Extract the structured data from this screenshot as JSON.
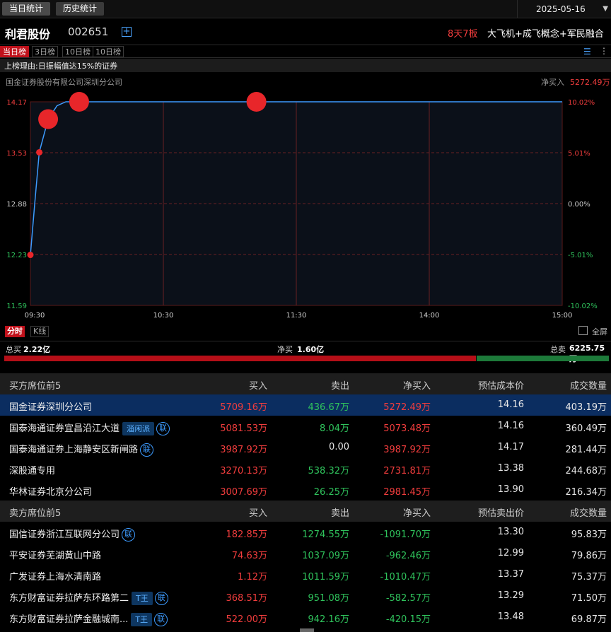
{
  "tabs": {
    "today": "当日统计",
    "history": "历史统计"
  },
  "date": "2025-05-16",
  "stock": {
    "name": "利君股份",
    "code": "002651",
    "board_count": "8天7板",
    "concept": "大飞机+成飞概念+军民融合"
  },
  "range_tabs": [
    "当日榜",
    "3日榜",
    "10日榜",
    "10日榜"
  ],
  "reason": "上榜理由:日振幅值达15%的证券",
  "broker": "国金证券股份有限公司深圳分公司",
  "net_buy": {
    "label": "净买入",
    "value": "5272.49万"
  },
  "chart_data": {
    "type": "line",
    "y_left_ticks": [
      "14.17",
      "13.53",
      "12.88",
      "12.23",
      "11.59"
    ],
    "y_right_ticks": [
      "10.02%",
      "5.01%",
      "0.00%",
      "-5.01%",
      "-10.02%"
    ],
    "y_range": [
      11.59,
      14.17
    ],
    "x_ticks": [
      "09:30",
      "10:30",
      "11:30",
      "14:00",
      "15:00"
    ],
    "line": [
      [
        0,
        12.23
      ],
      [
        2,
        12.9
      ],
      [
        4,
        13.53
      ],
      [
        8,
        13.95
      ],
      [
        12,
        14.12
      ],
      [
        16,
        14.17
      ],
      [
        240,
        14.17
      ]
    ],
    "points": [
      {
        "t": 0,
        "y": 12.23,
        "size": "small"
      },
      {
        "t": 4,
        "y": 13.53,
        "size": "small"
      },
      {
        "t": 8,
        "y": 13.95,
        "size": "large"
      },
      {
        "t": 22,
        "y": 14.17,
        "size": "large"
      },
      {
        "t": 102,
        "y": 14.17,
        "size": "large"
      }
    ]
  },
  "chart_controls": {
    "fenshi": "分时",
    "kline": "K线",
    "fullscreen": "全屏"
  },
  "totals": {
    "buy_label": "总买",
    "buy": "2.22亿",
    "net_label": "净买",
    "net": "1.60亿",
    "sell_label": "总卖",
    "sell": "6225.75万",
    "buy_ratio": 0.78
  },
  "buy_table": {
    "headers": [
      "买方席位前5",
      "买入",
      "卖出",
      "净买入",
      "预估成本价",
      "成交数量"
    ],
    "rows": [
      {
        "name": "国金证券深圳分公司",
        "tag": "",
        "lian": false,
        "buy": "5709.16万",
        "sell": "436.67万",
        "net": "5272.49万",
        "price": "14.16",
        "vol": "403.19万"
      },
      {
        "name": "国泰海通证券宜昌沿江大道",
        "tag": "淄闲派",
        "lian": true,
        "buy": "5081.53万",
        "sell": "8.04万",
        "net": "5073.48万",
        "price": "14.16",
        "vol": "360.49万"
      },
      {
        "name": "国泰海通证券上海静安区新闸路",
        "tag": "",
        "lian": true,
        "buy": "3987.92万",
        "sell": "0.00",
        "net": "3987.92万",
        "price": "14.17",
        "vol": "281.44万"
      },
      {
        "name": "深股通专用",
        "tag": "",
        "lian": false,
        "buy": "3270.13万",
        "sell": "538.32万",
        "net": "2731.81万",
        "price": "13.38",
        "vol": "244.68万"
      },
      {
        "name": "华林证券北京分公司",
        "tag": "",
        "lian": false,
        "buy": "3007.69万",
        "sell": "26.25万",
        "net": "2981.45万",
        "price": "13.90",
        "vol": "216.34万"
      }
    ]
  },
  "sell_table": {
    "headers": [
      "卖方席位前5",
      "买入",
      "卖出",
      "净买入",
      "预估卖出价",
      "成交数量"
    ],
    "rows": [
      {
        "name": "国信证券浙江互联网分公司",
        "tag": "",
        "lian": true,
        "buy": "182.85万",
        "sell": "1274.55万",
        "net": "-1091.70万",
        "price": "13.30",
        "vol": "95.83万"
      },
      {
        "name": "平安证券芜湖黄山中路",
        "tag": "",
        "lian": false,
        "buy": "74.63万",
        "sell": "1037.09万",
        "net": "-962.46万",
        "price": "12.99",
        "vol": "79.86万"
      },
      {
        "name": "广发证券上海水清南路",
        "tag": "",
        "lian": false,
        "buy": "1.12万",
        "sell": "1011.59万",
        "net": "-1010.47万",
        "price": "13.37",
        "vol": "75.37万"
      },
      {
        "name": "东方财富证券拉萨东环路第二",
        "tag": "T王",
        "lian": true,
        "buy": "368.51万",
        "sell": "951.08万",
        "net": "-582.57万",
        "price": "13.29",
        "vol": "71.50万"
      },
      {
        "name": "东方财富证券拉萨金融城南...",
        "tag": "T王",
        "lian": true,
        "buy": "522.00万",
        "sell": "942.16万",
        "net": "-420.15万",
        "price": "13.48",
        "vol": "69.87万"
      }
    ]
  },
  "lian_label": "联"
}
